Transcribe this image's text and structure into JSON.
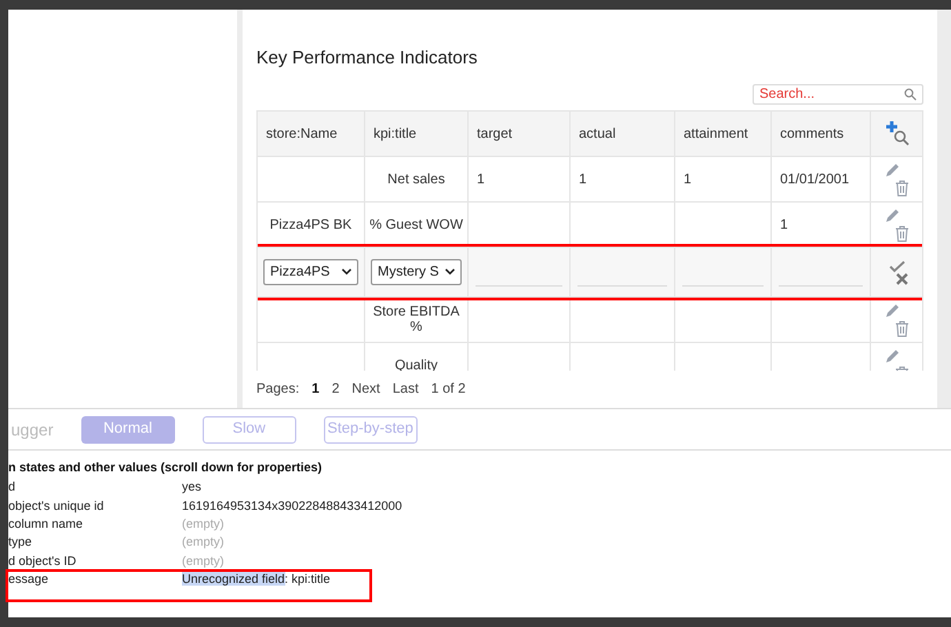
{
  "section_title": "Key Performance Indicators",
  "search": {
    "placeholder": "Search..."
  },
  "table": {
    "columns": [
      "store:Name",
      "kpi:title",
      "target",
      "actual",
      "attainment",
      "comments"
    ],
    "rows": [
      {
        "kind": "view",
        "cells": [
          "",
          "Net sales",
          "1",
          "1",
          "1",
          "01/01/2001"
        ]
      },
      {
        "kind": "view",
        "cells": [
          "Pizza4PS BK",
          "% Guest WOW",
          "",
          "",
          "",
          "1"
        ]
      },
      {
        "kind": "edit",
        "highlighted": true,
        "selects": [
          "Pizza4PS",
          "Mystery S"
        ]
      },
      {
        "kind": "view",
        "cells": [
          "",
          "Store EBITDA %",
          "",
          "",
          "",
          ""
        ]
      },
      {
        "kind": "view",
        "cells": [
          "",
          "Quality",
          "",
          "",
          "",
          ""
        ]
      }
    ]
  },
  "pager": {
    "label": "Pages:",
    "pages": [
      {
        "label": "1",
        "selected": true
      },
      {
        "label": "2",
        "selected": false
      }
    ],
    "next": "Next",
    "last": "Last",
    "count": "1 of 2"
  },
  "debugger": {
    "label": "ugger",
    "modes": [
      {
        "label": "Normal",
        "selected": true
      },
      {
        "label": "Slow",
        "selected": false
      },
      {
        "label": "Step-by-step",
        "selected": false
      }
    ],
    "heading": "n states and other values (scroll down for properties)",
    "rows": [
      {
        "name": "d",
        "value": "yes",
        "empty": false
      },
      {
        "name": "object's unique id",
        "value": "1619164953134x390228488433412000",
        "empty": false
      },
      {
        "name": "column name",
        "value": "(empty)",
        "empty": true
      },
      {
        "name": "type",
        "value": "(empty)",
        "empty": true
      },
      {
        "name": "d object's ID",
        "value": "(empty)",
        "empty": true
      },
      {
        "name": "essage",
        "value": "**Unrecognized field**: kpi:title",
        "empty": false,
        "highlighted": true
      }
    ]
  }
}
